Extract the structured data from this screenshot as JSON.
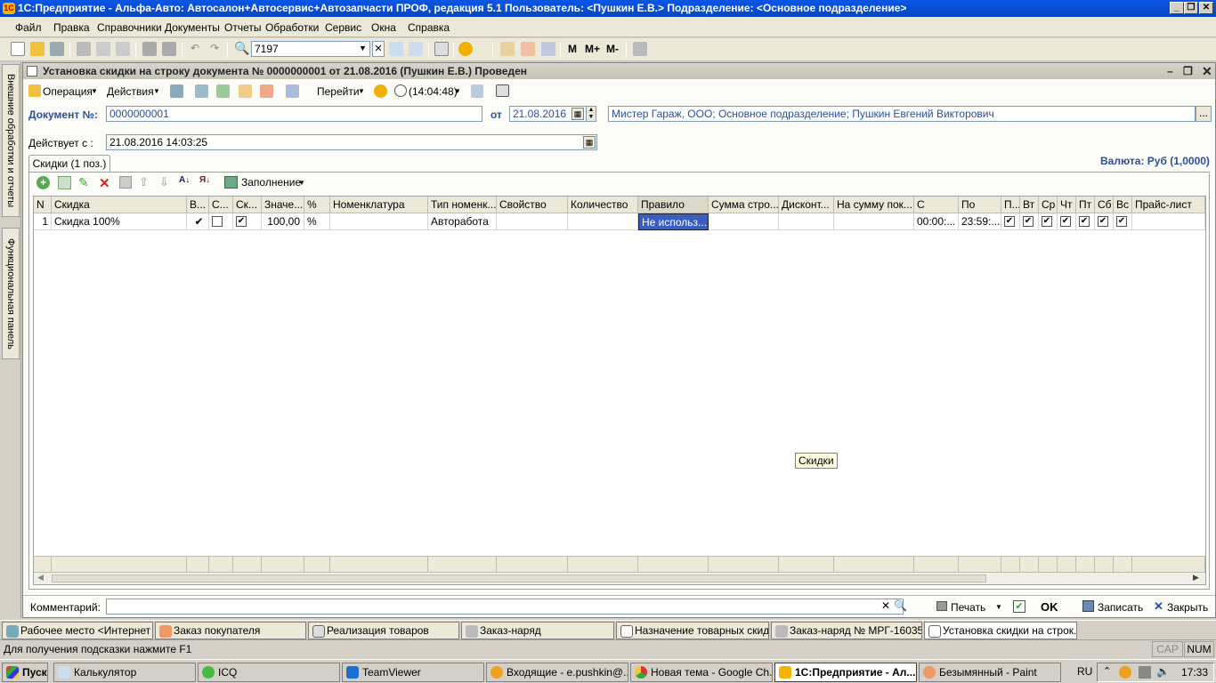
{
  "app": {
    "title": "1С:Предприятие - Альфа-Авто: Автосалон+Автосервис+Автозапчасти ПРОФ, редакция 5.1    Пользователь: <Пушкин Е.В.>    Подразделение: <Основное подразделение>"
  },
  "menu": [
    "Файл",
    "Правка",
    "Справочники",
    "Документы",
    "Отчеты",
    "Обработки",
    "Сервис",
    "Окна",
    "Справка"
  ],
  "search": {
    "value": "7197"
  },
  "toolbar_text": {
    "m": "М",
    "mplus": "М+",
    "mminus": "М-"
  },
  "left_tabs": [
    "Внешние обработки и отчеты",
    "Функциональная панель"
  ],
  "document": {
    "title": "Установка скидки на строку документа № 0000000001 от 21.08.2016 (Пушкин Е.В.) Проведен",
    "toolbar": {
      "operation": "Операция",
      "actions": "Действия",
      "goto": "Перейти",
      "time": "(14:04:48)"
    },
    "number_label": "Документ №:",
    "number": "0000000001",
    "date_label": "от",
    "date": "21.08.2016",
    "org": "Мистер Гараж, ООО; Основное подразделение; Пушкин Евгений Викторович",
    "valid_from_label": "Действует с :",
    "valid_from": "21.08.2016 14:03:25",
    "tab": "Скидки (1 поз.)",
    "currency": "Валюта: Руб (1,0000)",
    "fill_label": "Заполнение",
    "columns": [
      "N",
      "Скидка",
      "В...",
      "С...",
      "Ск...",
      "Значе...",
      "%",
      "Номенклатура",
      "Тип номенк...",
      "Свойство",
      "Количество",
      "Правило",
      "Сумма стро...",
      "Дисконт...",
      "На сумму пок...",
      "С",
      "По",
      "П...",
      "Вт",
      "Ср",
      "Чт",
      "Пт",
      "Сб",
      "Вс",
      "Прайс-лист"
    ],
    "rows": [
      {
        "n": "1",
        "discount": "Скидка 100%",
        "value": "100,00",
        "pct": "%",
        "type": "Авторабота",
        "rule": "Не использ...",
        "from": "00:00:...",
        "to": "23:59:..."
      }
    ],
    "tooltip": "Скидки",
    "comment_label": "Комментарий:",
    "print": "Печать",
    "ok": "OK",
    "save": "Записать",
    "close": "Закрыть"
  },
  "inner_tasks": [
    "Рабочее место <Интернет ...",
    "Заказ покупателя",
    "Реализация товаров",
    "Заказ-наряд",
    "Назначение товарных скид...",
    "Заказ-наряд № МРГ-16035...",
    "Установка скидки на строк..."
  ],
  "status": {
    "hint": "Для получения подсказки нажмите F1",
    "cap": "CAP",
    "num": "NUM"
  },
  "taskbar": {
    "start": "Пуск",
    "items": [
      "Калькулятор",
      "ICQ",
      "TeamViewer",
      "Входящие - e.pushkin@...",
      "Новая тема - Google Ch...",
      "1С:Предприятие - Ал...",
      "Безымянный - Paint"
    ],
    "lang": "RU",
    "clock": "17:33"
  }
}
